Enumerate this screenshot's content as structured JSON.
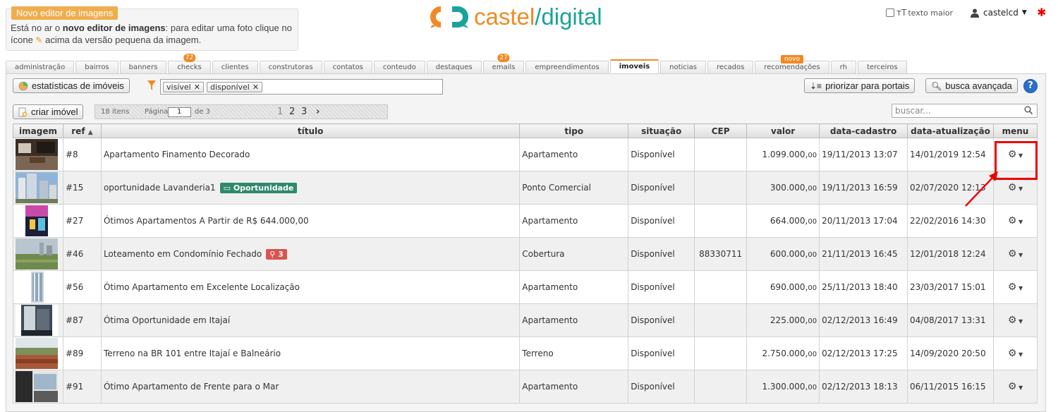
{
  "notice": {
    "tag": "Novo editor de imagens",
    "text_pre": "Está no ar o ",
    "text_bold": "novo editor de imagens",
    "text_mid": ": para editar uma foto clique no ícone ",
    "text_post": " acima da versão pequena da imagem."
  },
  "brand": {
    "name1": "castel",
    "sep": "/",
    "name2": "digital"
  },
  "header": {
    "bigger_text_label": "texto maior",
    "user": "castelcd"
  },
  "tabs": [
    {
      "label": "administração"
    },
    {
      "label": "bairros"
    },
    {
      "label": "banners"
    },
    {
      "label": "checks",
      "badge": "72"
    },
    {
      "label": "clientes"
    },
    {
      "label": "construtoras"
    },
    {
      "label": "contatos"
    },
    {
      "label": "conteudo"
    },
    {
      "label": "destaques"
    },
    {
      "label": "emails",
      "badge": "27"
    },
    {
      "label": "empreendimentos"
    },
    {
      "label": "imoveis",
      "active": true
    },
    {
      "label": "noticias"
    },
    {
      "label": "recados"
    },
    {
      "label": "recomendações",
      "badge": "novo"
    },
    {
      "label": "rh"
    },
    {
      "label": "terceiros"
    }
  ],
  "toolbar": {
    "stats_label": "estatísticas de imóveis",
    "filters": [
      "visível",
      "disponível"
    ],
    "prioritize_label": "priorizar para portais",
    "advanced_search_label": "busca avançada",
    "create_label": "criar imóvel",
    "items_count": "18 itens",
    "page_label": "Página",
    "page_value": "1",
    "page_of": "de 3",
    "pages": [
      "1",
      "2",
      "3"
    ],
    "search_placeholder": "buscar..."
  },
  "table": {
    "columns": [
      "imagem",
      "ref",
      "título",
      "tipo",
      "situação",
      "CEP",
      "valor",
      "data-cadastro",
      "data-atualização",
      "menu"
    ],
    "sort_glyph": "▲",
    "rows": [
      {
        "ref": "#8",
        "title": "Apartamento Finamento Decorado",
        "tipo": "Apartamento",
        "situacao": "Disponível",
        "cep": "",
        "valor": "1.099.000,",
        "cents": "00",
        "cadastro": "19/11/2013 13:07",
        "atualizacao": "14/01/2019 12:54"
      },
      {
        "ref": "#15",
        "title": "oportunidade Lavanderia1",
        "tag": "Oportunidade",
        "tipo": "Ponto Comercial",
        "situacao": "Disponível",
        "cep": "",
        "valor": "300.000,",
        "cents": "00",
        "cadastro": "19/11/2013 16:59",
        "atualizacao": "02/07/2020 12:13"
      },
      {
        "ref": "#27",
        "title": "Ótimos Apartamentos A Partir de R$ 644.000,00",
        "tipo": "Apartamento",
        "situacao": "Disponível",
        "cep": "",
        "valor": "664.000,",
        "cents": "00",
        "cadastro": "20/11/2013 17:04",
        "atualizacao": "22/02/2016 14:30"
      },
      {
        "ref": "#46",
        "title": "Loteamento em Condomínio Fechado",
        "pin": "3",
        "tipo": "Cobertura",
        "situacao": "Disponível",
        "cep": "88330711",
        "valor": "600.000,",
        "cents": "00",
        "cadastro": "21/11/2013 16:45",
        "atualizacao": "12/01/2018 12:24"
      },
      {
        "ref": "#56",
        "title": "Ótimo Apartamento em Excelente Localização",
        "tipo": "Apartamento",
        "situacao": "Disponível",
        "cep": "",
        "valor": "690.000,",
        "cents": "00",
        "cadastro": "25/11/2013 18:40",
        "atualizacao": "23/03/2017 15:01"
      },
      {
        "ref": "#87",
        "title": "Ótima Oportunidade em Itajaí",
        "tipo": "Apartamento",
        "situacao": "Disponível",
        "cep": "",
        "valor": "225.000,",
        "cents": "00",
        "cadastro": "02/12/2013 16:49",
        "atualizacao": "04/08/2017 13:31"
      },
      {
        "ref": "#89",
        "title": "Terreno na BR 101 entre Itajaí e Balneário",
        "tipo": "Terreno",
        "situacao": "Disponível",
        "cep": "",
        "valor": "2.750.000,",
        "cents": "00",
        "cadastro": "02/12/2013 17:25",
        "atualizacao": "14/09/2020 20:50"
      },
      {
        "ref": "#91",
        "title": "Ótimo Apartamento de Frente para o Mar",
        "tipo": "Apartamento",
        "situacao": "Disponível",
        "cep": "",
        "valor": "1.300.000,",
        "cents": "00",
        "cadastro": "02/12/2013 18:13",
        "atualizacao": "06/11/2015 16:15"
      }
    ]
  },
  "colors": {
    "brand_orange": "#f08a24",
    "brand_teal": "#1aa39a",
    "status_green": "#2f8a2f",
    "highlight_red": "#e00000"
  },
  "icons": [
    "edit-icon",
    "checkbox-icon",
    "text-size-icon",
    "user-icon",
    "asterisk-icon",
    "chart-icon",
    "funnel-icon",
    "sort-icon",
    "search-icon",
    "help-icon",
    "add-icon",
    "gear-icon",
    "card-icon",
    "pin-icon",
    "image-thumbnail"
  ]
}
